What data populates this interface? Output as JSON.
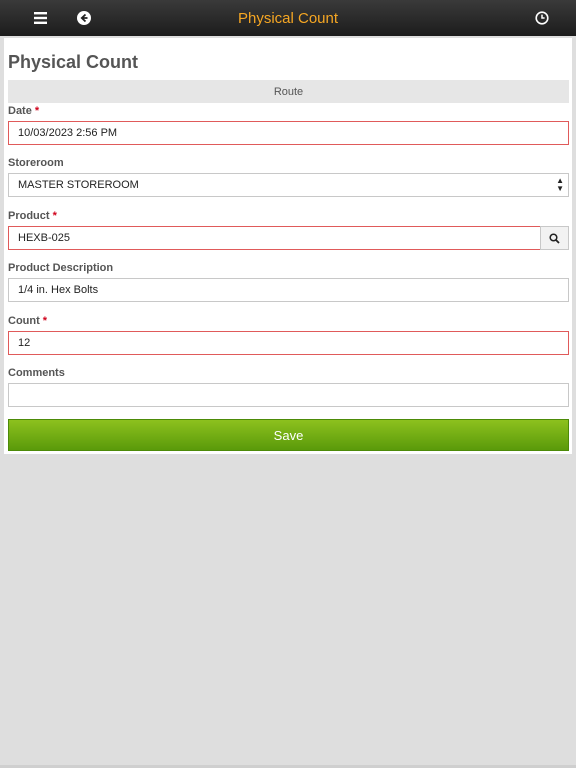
{
  "header": {
    "title": "Physical Count",
    "menu_icon": "hamburger-menu-icon",
    "back_icon": "back-arrow-icon",
    "history_icon": "clock-icon"
  },
  "page": {
    "title": "Physical Count",
    "route_label": "Route"
  },
  "form": {
    "date": {
      "label": "Date",
      "required_mark": "*",
      "value": "10/03/2023 2:56 PM"
    },
    "storeroom": {
      "label": "Storeroom",
      "value": "MASTER STOREROOM"
    },
    "product": {
      "label": "Product",
      "required_mark": "*",
      "value": "HEXB-025"
    },
    "product_description": {
      "label": "Product Description",
      "value": "1/4 in. Hex Bolts"
    },
    "count": {
      "label": "Count",
      "required_mark": "*",
      "value": "12"
    },
    "comments": {
      "label": "Comments",
      "value": ""
    }
  },
  "actions": {
    "save_label": "Save"
  },
  "colors": {
    "header_title": "#f5a623",
    "required_border": "#e05a5a",
    "save_button": "#6aaa12"
  }
}
